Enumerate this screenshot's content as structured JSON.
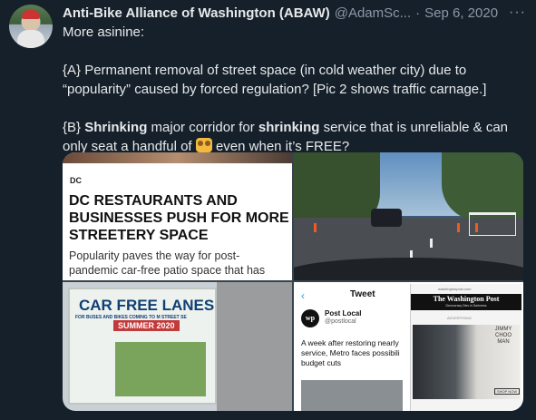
{
  "tweet": {
    "name": "Anti-Bike Alliance of Washington (ABAW)",
    "handle": "@AdamSc...",
    "separator": "·",
    "date": "Sep 6, 2020",
    "more_icon": "···",
    "line1": "More asinine:",
    "line2": "{A} Permanent removal of street space (in cold weather city) due to “popularity” caused by forced regulation? [Pic 2 shows traffic carnage.]",
    "line3_pre": "{B} ",
    "line3_b1": "Shrinking",
    "line3_mid": " major corridor for ",
    "line3_b2": "shrinking",
    "line3_post": " service that is unreliable & can only seat a handful of ",
    "line3_end": " even when it’s FREE?",
    "emoji_icon": "people-emoji"
  },
  "media": {
    "img1": {
      "section": "DC",
      "headline": "DC RESTAURANTS AND BUSINESSES PUSH FOR MORE STREETERY SPACE",
      "dek": "Popularity paves the way for post-pandemic car-free patio space that has"
    },
    "img3": {
      "title": "CAR FREE LANES",
      "subtitle": "FOR BUSES AND BIKES COMING TO M STREET SE",
      "date": "SUMMER 2020"
    },
    "img4": {
      "back": "‹",
      "tweet_label": "Tweet",
      "logo": "wp",
      "account": "Post Local",
      "account_handle": "@postlocal",
      "text": "A week after restoring nearly service, Metro faces possibili budget cuts",
      "wp_url": "washingtonpost.com",
      "wp_masthead": "The Washington Post",
      "wp_tagline": "Democracy Dies in Darkness",
      "ad_label": "ADVERTISING",
      "ad_text": "JIMMY CHOO MAN",
      "ad_shop": "SHOP NOW"
    }
  }
}
